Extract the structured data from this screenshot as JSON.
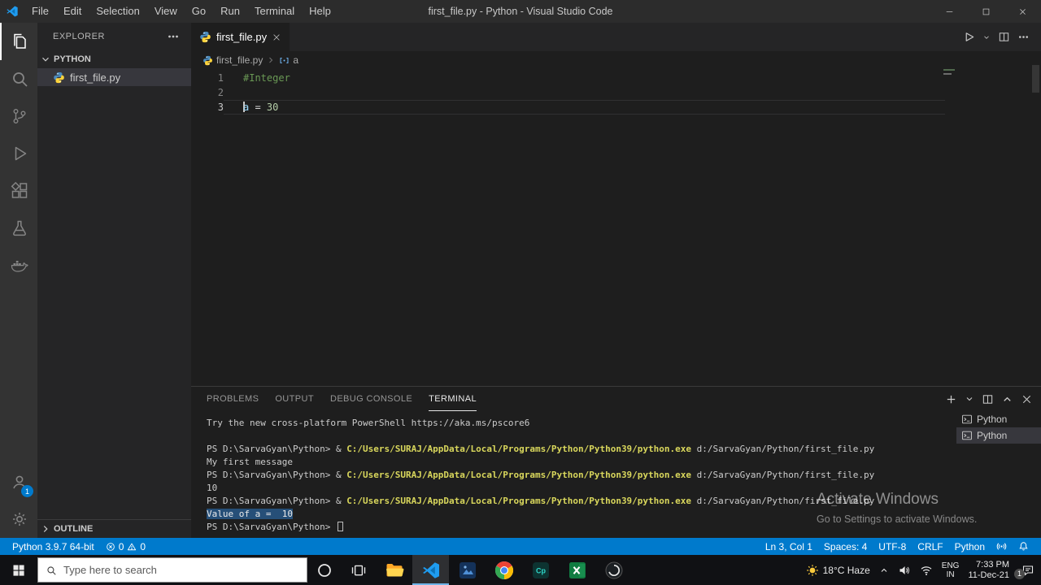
{
  "titlebar": {
    "menus": [
      "File",
      "Edit",
      "Selection",
      "View",
      "Go",
      "Run",
      "Terminal",
      "Help"
    ],
    "title": "first_file.py - Python - Visual Studio Code"
  },
  "activity_bar": {
    "top": [
      {
        "name": "explorer",
        "icon": "files-icon",
        "active": true
      },
      {
        "name": "search",
        "icon": "search-icon"
      },
      {
        "name": "source-control",
        "icon": "source-control-icon"
      },
      {
        "name": "run-and-debug",
        "icon": "run-debug-icon"
      },
      {
        "name": "extensions",
        "icon": "extensions-icon"
      },
      {
        "name": "testing",
        "icon": "beaker-icon"
      },
      {
        "name": "docker",
        "icon": "docker-icon"
      }
    ],
    "bottom": [
      {
        "name": "accounts",
        "icon": "account-icon",
        "badge": "1"
      },
      {
        "name": "settings",
        "icon": "gear-icon"
      }
    ]
  },
  "sidebar": {
    "title": "EXPLORER",
    "section_label": "PYTHON",
    "files": [
      {
        "label": "first_file.py",
        "icon": "python-icon",
        "selected": true
      }
    ],
    "outline_label": "OUTLINE"
  },
  "editor": {
    "tabs": [
      {
        "label": "first_file.py",
        "icon": "python-icon",
        "active": true
      }
    ],
    "breadcrumb": {
      "file": "first_file.py",
      "symbol": "a"
    },
    "code_lines": [
      {
        "num": "1",
        "tokens": [
          {
            "text": "#Integer",
            "style": "comment"
          }
        ]
      },
      {
        "num": "2",
        "tokens": []
      },
      {
        "num": "3",
        "current": true,
        "tokens": [
          {
            "text": "a",
            "style": "variable",
            "cursor_before": true
          },
          {
            "text": " = ",
            "style": "plain"
          },
          {
            "text": "30",
            "style": "number"
          }
        ]
      }
    ]
  },
  "panel": {
    "tabs": [
      {
        "label": "PROBLEMS"
      },
      {
        "label": "OUTPUT"
      },
      {
        "label": "DEBUG CONSOLE"
      },
      {
        "label": "TERMINAL",
        "active": true
      }
    ],
    "terminal_lines": [
      {
        "segments": [
          {
            "text": "Try the new cross-platform PowerShell https://aka.ms/pscore6",
            "style": "plain"
          }
        ]
      },
      {
        "segments": []
      },
      {
        "segments": [
          {
            "text": "PS D:\\SarvaGyan\\Python> & ",
            "style": "plain"
          },
          {
            "text": "C:/Users/SURAJ/AppData/Local/Programs/Python/Python39/python.exe",
            "style": "command"
          },
          {
            "text": " d:/SarvaGyan/Python/first_file.py",
            "style": "plain"
          }
        ]
      },
      {
        "segments": [
          {
            "text": "My first message",
            "style": "plain"
          }
        ]
      },
      {
        "segments": [
          {
            "text": "PS D:\\SarvaGyan\\Python> & ",
            "style": "plain"
          },
          {
            "text": "C:/Users/SURAJ/AppData/Local/Programs/Python/Python39/python.exe",
            "style": "command"
          },
          {
            "text": " d:/SarvaGyan/Python/first_file.py",
            "style": "plain"
          }
        ]
      },
      {
        "segments": [
          {
            "text": "10",
            "style": "plain"
          }
        ]
      },
      {
        "segments": [
          {
            "text": "PS D:\\SarvaGyan\\Python> & ",
            "style": "plain"
          },
          {
            "text": "C:/Users/SURAJ/AppData/Local/Programs/Python/Python39/python.exe",
            "style": "command"
          },
          {
            "text": " d:/SarvaGyan/Python/first_file.py",
            "style": "plain"
          }
        ]
      },
      {
        "segments": [
          {
            "text": "Value of a =  10",
            "style": "selected"
          }
        ]
      },
      {
        "segments": [
          {
            "text": "PS D:\\SarvaGyan\\Python> ",
            "style": "plain"
          }
        ],
        "cursor": true
      }
    ],
    "terminal_list": [
      {
        "label": "Python",
        "icon": "terminal-icon"
      },
      {
        "label": "Python",
        "icon": "terminal-icon",
        "selected": true
      }
    ]
  },
  "status_bar": {
    "python_version": "Python 3.9.7 64-bit",
    "errors": "0",
    "warnings": "0",
    "right_items": [
      "Ln 3, Col 1",
      "Spaces: 4",
      "UTF-8",
      "CRLF",
      "Python"
    ]
  },
  "watermark": {
    "title": "Activate Windows",
    "subtitle": "Go to Settings to activate Windows."
  },
  "taskbar": {
    "search_placeholder": "Type here to search",
    "apps": [
      {
        "name": "file-explorer",
        "icon": "folder-icon"
      },
      {
        "name": "vscode",
        "icon": "vscode-icon",
        "active": true
      },
      {
        "name": "photos",
        "icon": "photos-icon"
      },
      {
        "name": "chrome",
        "icon": "chrome-icon"
      },
      {
        "name": "camtasia",
        "icon": "camtasia-icon"
      },
      {
        "name": "excel",
        "icon": "excel-icon"
      },
      {
        "name": "obs",
        "icon": "obs-icon"
      }
    ],
    "tray": {
      "weather": "18°C Haze",
      "lang_top": "ENG",
      "lang_bottom": "IN",
      "time": "7:33 PM",
      "date": "11-Dec-21",
      "notification_badge": "1"
    }
  }
}
